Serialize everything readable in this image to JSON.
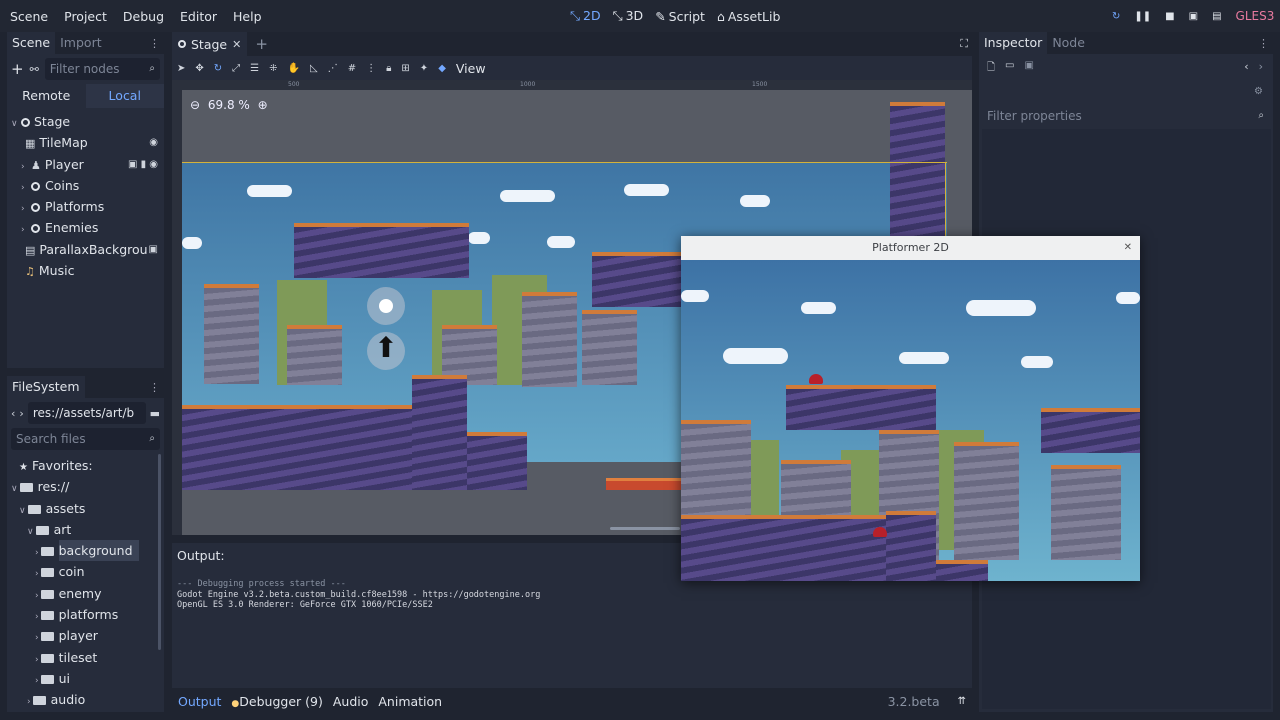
{
  "menu": {
    "items": [
      "Scene",
      "Project",
      "Debug",
      "Editor",
      "Help"
    ]
  },
  "workspaces": [
    {
      "label": "2D",
      "icon": "2d-icon",
      "active": true
    },
    {
      "label": "3D",
      "icon": "3d-icon"
    },
    {
      "label": "Script",
      "icon": "script-icon"
    },
    {
      "label": "AssetLib",
      "icon": "assetlib-icon"
    }
  ],
  "renderer": "GLES3",
  "scene_dock": {
    "tabs": [
      "Scene",
      "Import"
    ],
    "filter_placeholder": "Filter nodes",
    "remote_label": "Remote",
    "local_label": "Local",
    "nodes": [
      "Stage",
      "TileMap",
      "Player",
      "Coins",
      "Platforms",
      "Enemies",
      "ParallaxBackgrou",
      "Music"
    ]
  },
  "filesystem": {
    "title": "FileSystem",
    "path": "res://assets/art/b",
    "search_placeholder": "Search files",
    "items": [
      "Favorites:",
      "res://",
      "assets",
      "art",
      "background",
      "coin",
      "enemy",
      "platforms",
      "player",
      "tileset",
      "ui",
      "audio"
    ]
  },
  "editor": {
    "tab_label": "Stage",
    "view_menu": "View",
    "zoom": "69.8 %",
    "ruler_ticks": [
      "500",
      "1000",
      "1500"
    ]
  },
  "output": {
    "title": "Output:",
    "lines": [
      "--- Debugging process started ---",
      "Godot Engine v3.2.beta.custom_build.cf8ee1598 - https://godotengine.org",
      "OpenGL ES 3.0 Renderer: GeForce GTX 1060/PCIe/SSE2"
    ]
  },
  "bottom_tabs": [
    "Output",
    "Debugger (9)",
    "Audio",
    "Animation"
  ],
  "version": "3.2.beta",
  "game_window": {
    "title": "Platformer 2D"
  },
  "inspector": {
    "tabs": [
      "Inspector",
      "Node"
    ],
    "filter_placeholder": "Filter properties"
  },
  "colors": {
    "accent": "#73a8ff",
    "background": "#1f2430",
    "panel": "#262c3b",
    "gles": "#e87a9f"
  }
}
